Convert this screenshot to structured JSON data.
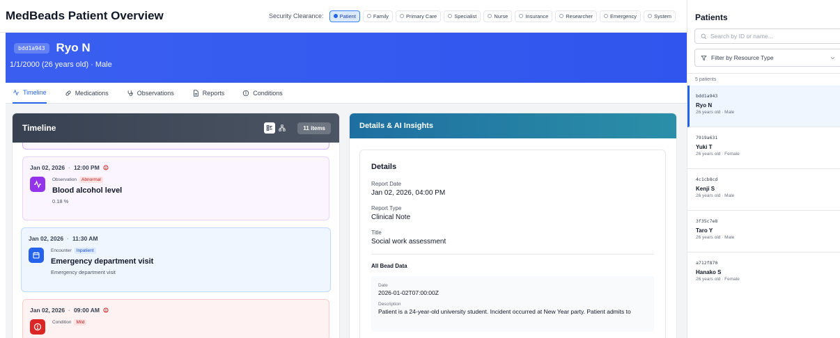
{
  "app": {
    "title": "MedBeads Patient Overview"
  },
  "clearance": {
    "label": "Security Clearance:",
    "options": [
      "Patient",
      "Family",
      "Primary Care",
      "Specialist",
      "Nurse",
      "Insurance",
      "Researcher",
      "Emergency",
      "System"
    ],
    "selected": "Patient"
  },
  "patient": {
    "id": "bdd1a943",
    "name": "Ryo N",
    "subtitle": "1/1/2000 (26 years old)  ·  Male"
  },
  "tabs": [
    {
      "label": "Timeline",
      "icon": "activity-icon",
      "active": true
    },
    {
      "label": "Medications",
      "icon": "pill-icon",
      "active": false
    },
    {
      "label": "Observations",
      "icon": "stethoscope-icon",
      "active": false
    },
    {
      "label": "Reports",
      "icon": "document-icon",
      "active": false
    },
    {
      "label": "Conditions",
      "icon": "info-icon",
      "active": false
    }
  ],
  "timeline": {
    "title": "Timeline",
    "count": "11 items",
    "items": [
      {
        "date": "Jan 02, 2026",
        "time": "12:00 PM",
        "type": "Observation",
        "tag": "Abnormal",
        "title": "Blood alcohol level",
        "desc": "0.18 %",
        "color": "#9333ea"
      },
      {
        "date": "Jan 02, 2026",
        "time": "11:30 AM",
        "type": "Encounter",
        "tag": "Inpatient",
        "title": "Emergency department visit",
        "desc": "Emergency department visit",
        "color": "#2563eb"
      },
      {
        "date": "Jan 02, 2026",
        "time": "09:00 AM",
        "type": "Condition",
        "tag": "Mild",
        "title": "",
        "desc": "",
        "color": "#dc2626"
      }
    ]
  },
  "details": {
    "header": "Details & AI Insights",
    "heading": "Details",
    "fields": [
      {
        "label": "Report Date",
        "value": "Jan 02, 2026, 04:00 PM"
      },
      {
        "label": "Report Type",
        "value": "Clinical Note"
      },
      {
        "label": "Title",
        "value": "Social work assessment"
      }
    ],
    "bead_heading": "All Bead Data",
    "bead": [
      {
        "label": "Date",
        "value": "2026-01-02T07:00:00Z"
      },
      {
        "label": "Description",
        "value": "Patient is a 24-year-old university student. Incident occurred at New Year party. Patient admits to"
      }
    ]
  },
  "sidebar": {
    "title": "Patients",
    "search_placeholder": "Search by ID or name...",
    "filter_label": "Filter by Resource Type",
    "count": "5 patients",
    "patients": [
      {
        "id": "bdd1a943",
        "name": "Ryo N",
        "sub": "26 years old  ·  Male",
        "active": true
      },
      {
        "id": "7919a631",
        "name": "Yuki T",
        "sub": "26 years old  ·  Female",
        "active": false
      },
      {
        "id": "4c1cb8cd",
        "name": "Kenji S",
        "sub": "26 years old  ·  Male",
        "active": false
      },
      {
        "id": "3f35c7e8",
        "name": "Taro Y",
        "sub": "26 years old  ·  Male",
        "active": false
      },
      {
        "id": "a712f870",
        "name": "Hanako S",
        "sub": "26 years old  ·  Female",
        "active": false
      }
    ]
  }
}
